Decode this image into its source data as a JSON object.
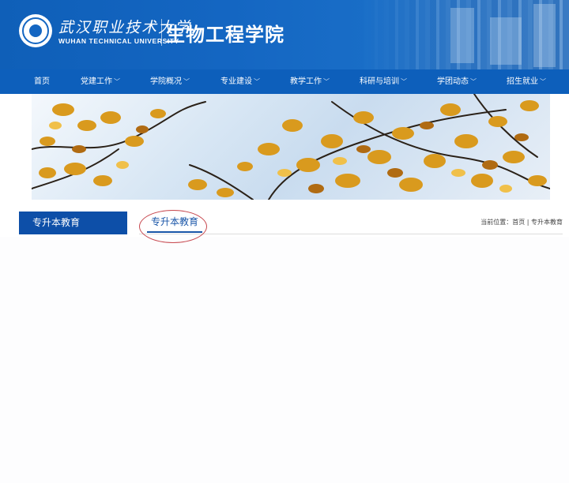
{
  "header": {
    "university_cn": "武汉职业技术大学",
    "university_en": "WUHAN TECHNICAL UNIVERSITY",
    "college_name": "生物工程学院"
  },
  "nav": {
    "items": [
      {
        "label": "首页",
        "has_dropdown": false
      },
      {
        "label": "党建工作",
        "has_dropdown": true
      },
      {
        "label": "学院概况",
        "has_dropdown": true
      },
      {
        "label": "专业建设",
        "has_dropdown": true
      },
      {
        "label": "教学工作",
        "has_dropdown": true
      },
      {
        "label": "科研与培训",
        "has_dropdown": true
      },
      {
        "label": "学团动态",
        "has_dropdown": true
      },
      {
        "label": "招生就业",
        "has_dropdown": true
      }
    ],
    "dropdown_glyph": "﹀"
  },
  "sidebar": {
    "title": "专升本教育"
  },
  "content": {
    "tab_title": "专升本教育"
  },
  "breadcrumb": {
    "prefix": "当前位置：",
    "home": "首页",
    "separator": " | ",
    "current": "专升本教育"
  },
  "colors": {
    "header_blue": "#1466c2",
    "nav_blue": "#0d5fbb",
    "sidebar_blue": "#0d4fa8",
    "accent_text": "#1a56a8",
    "annotation_red": "#c7484f"
  }
}
